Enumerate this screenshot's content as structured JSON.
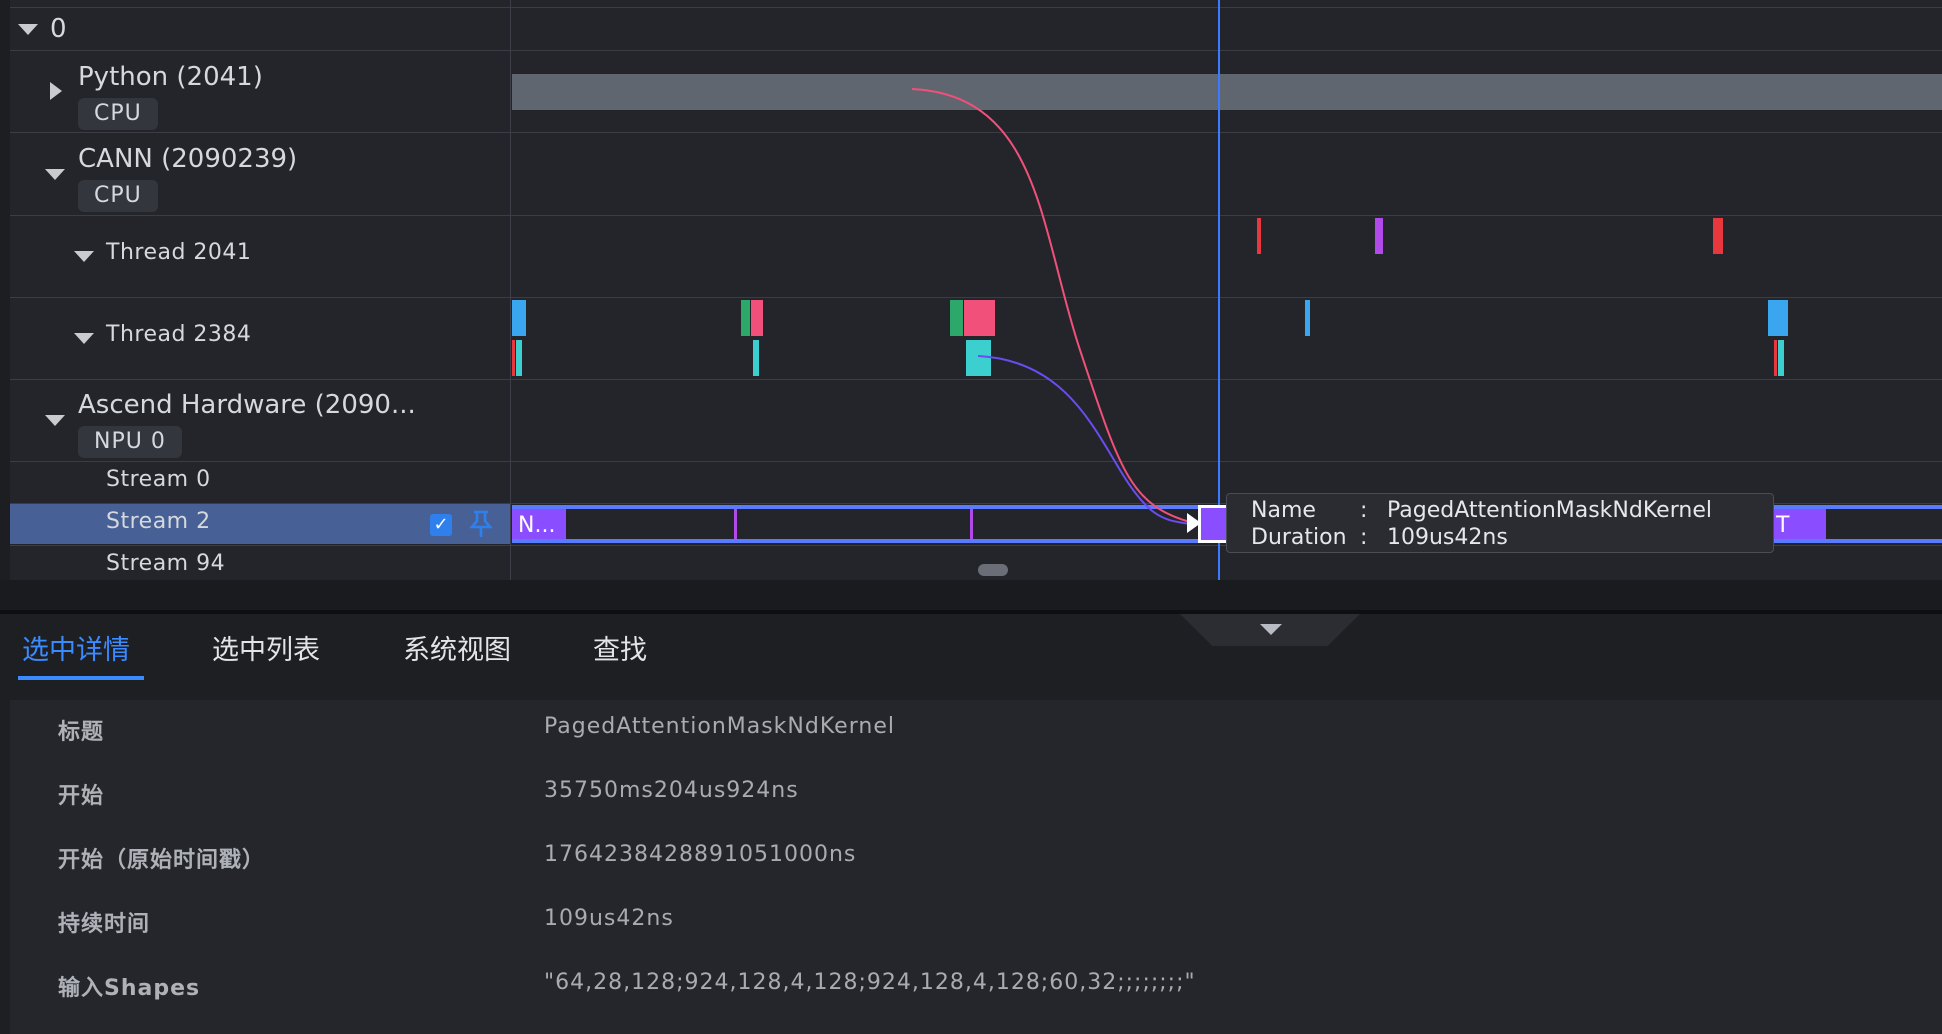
{
  "timeline": {
    "root_label": "0",
    "processes": [
      {
        "name": "Python (2041)",
        "chip": "CPU"
      },
      {
        "name": "CANN (2090239)",
        "chip": "CPU"
      },
      {
        "name": "Ascend Hardware (2090...",
        "chip": "NPU 0"
      }
    ],
    "threads": [
      {
        "name": "Thread 2041"
      },
      {
        "name": "Thread 2384"
      }
    ],
    "streams": [
      {
        "name": "Stream 0"
      },
      {
        "name": "Stream 2"
      },
      {
        "name": "Stream 94"
      }
    ],
    "stream2_first_slice": "N...",
    "stream2_last_slice": "T",
    "tooltip": {
      "name_key": "Name",
      "name_colon": ":",
      "name_value": "PagedAttentionMaskNdKernel",
      "duration_key": "Duration",
      "duration_colon": ":",
      "duration_value": "109us42ns"
    },
    "colors": {
      "flow_pink": "#f0507a",
      "flow_purple": "#6a4cf0",
      "cursor": "#3b7bff",
      "kernel": "#8a4dff"
    }
  },
  "tabs": [
    {
      "label": "选中详情",
      "active": true
    },
    {
      "label": "选中列表",
      "active": false
    },
    {
      "label": "系统视图",
      "active": false
    },
    {
      "label": "查找",
      "active": false
    }
  ],
  "details": [
    {
      "key": "标题",
      "value": "PagedAttentionMaskNdKernel"
    },
    {
      "key": "开始",
      "value": "35750ms204us924ns"
    },
    {
      "key": "开始（原始时间戳）",
      "value": "1764238428891051000ns"
    },
    {
      "key": "持续时间",
      "value": "109us42ns"
    },
    {
      "key": "输入Shapes",
      "value": "\"64,28,128;924,128,4,128;924,128,4,128;60,32;;;;;;;;\""
    }
  ]
}
